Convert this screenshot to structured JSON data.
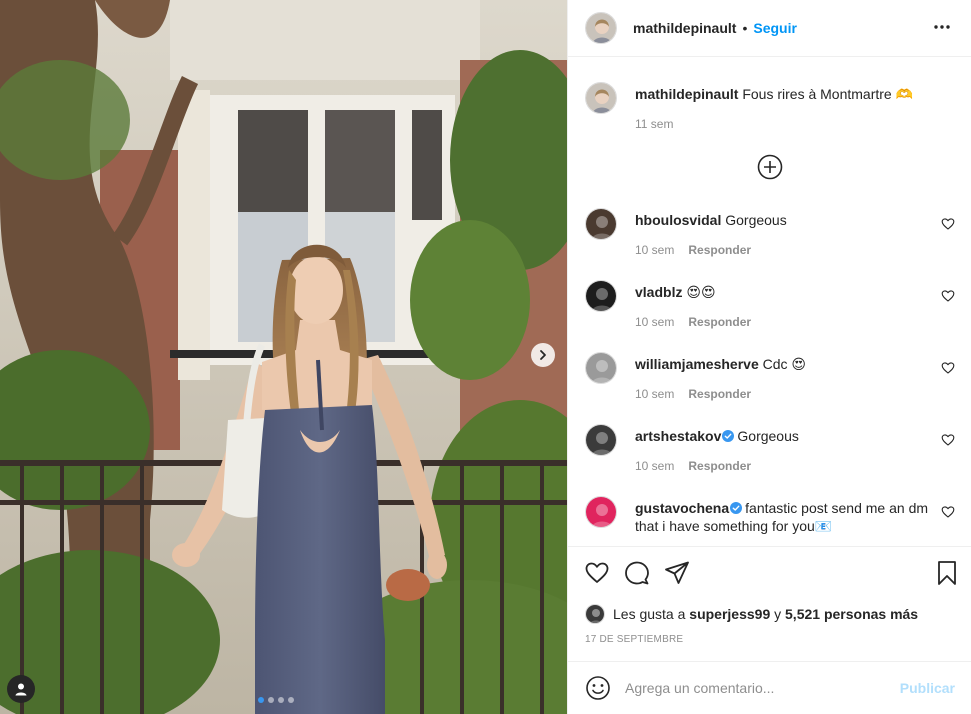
{
  "post": {
    "username": "mathildepinault",
    "separator": "•",
    "follow_label": "Seguir",
    "more_icon": "more-horizontal-icon",
    "caption_user": "mathildepinault",
    "caption_text": "Fous rires à Montmartre 🫶",
    "caption_time": "11 sem",
    "load_more_icon": "plus-circle-icon",
    "carousel_slides": 4,
    "carousel_active": 1
  },
  "comments": [
    {
      "user": "hboulosvidal",
      "verified": false,
      "text": "Gorgeous",
      "time": "10 sem",
      "reply": "Responder",
      "avatar_color": "#4a3a30"
    },
    {
      "user": "vladblz",
      "verified": false,
      "text": "😍😍",
      "time": "10 sem",
      "reply": "Responder",
      "avatar_color": "#1d1d1d"
    },
    {
      "user": "williamjamesherve",
      "verified": false,
      "text": "Cdc 😍",
      "time": "10 sem",
      "reply": "Responder",
      "avatar_color": "#9a9a9a"
    },
    {
      "user": "artshestakov",
      "verified": true,
      "text": "Gorgeous",
      "time": "10 sem",
      "reply": "Responder",
      "avatar_color": "#3b3b3b"
    },
    {
      "user": "gustavochena",
      "verified": true,
      "text": "fantastic post send me an dm that i have something for you📧",
      "time": "",
      "reply": "",
      "avatar_color": "#e0245e"
    }
  ],
  "likes": {
    "prefix": "Les gusta a",
    "user": "superjess99",
    "middle": "y",
    "count_text": "5,521 personas más"
  },
  "date": "17 DE SEPTIEMBRE",
  "composer": {
    "placeholder": "Agrega un comentario...",
    "publish_label": "Publicar"
  },
  "colors": {
    "accent": "#0095f6",
    "publish_disabled": "#b2dffc",
    "muted": "#8e8e8e",
    "border": "#efefef"
  }
}
